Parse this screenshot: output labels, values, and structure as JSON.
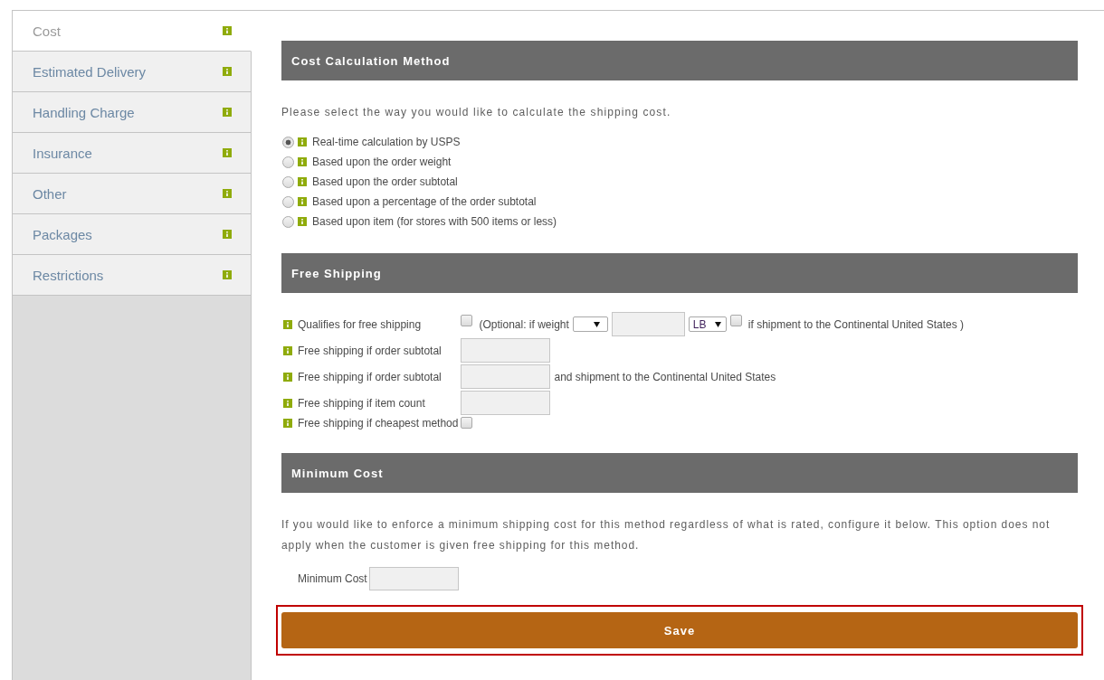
{
  "sidebar": {
    "items": [
      {
        "label": "Cost",
        "selected": true
      },
      {
        "label": "Estimated Delivery",
        "selected": false
      },
      {
        "label": "Handling Charge",
        "selected": false
      },
      {
        "label": "Insurance",
        "selected": false
      },
      {
        "label": "Other",
        "selected": false
      },
      {
        "label": "Packages",
        "selected": false
      },
      {
        "label": "Restrictions",
        "selected": false
      }
    ]
  },
  "cost_calculation_method": {
    "title": "Cost Calculation Method",
    "description": "Please select the way you would like to calculate the shipping cost.",
    "options": [
      {
        "label": "Real-time calculation by USPS",
        "selected": true
      },
      {
        "label": "Based upon the order weight",
        "selected": false
      },
      {
        "label": "Based upon the order subtotal",
        "selected": false
      },
      {
        "label": "Based upon a percentage of the order subtotal",
        "selected": false
      },
      {
        "label": "Based upon item (for stores with 500 items or less)",
        "selected": false
      }
    ]
  },
  "free_shipping": {
    "title": "Free Shipping",
    "rows": [
      {
        "label": "Qualifies for free shipping",
        "controls": [
          {
            "kind": "checkbox",
            "checked": false
          },
          {
            "kind": "text",
            "text": "(Optional: if weight"
          },
          {
            "kind": "select"
          },
          {
            "kind": "input"
          },
          {
            "kind": "select",
            "value": "LB"
          },
          {
            "kind": "checkbox",
            "checked": false
          },
          {
            "kind": "text",
            "text": "if shipment to the Continental United States )"
          }
        ]
      },
      {
        "label": "Free shipping if order subtotal",
        "controls": [
          {
            "kind": "input"
          }
        ]
      },
      {
        "label": "Free shipping if order subtotal",
        "controls": [
          {
            "kind": "input"
          },
          {
            "kind": "text",
            "text": "and shipment to the Continental United States"
          }
        ]
      },
      {
        "label": "Free shipping if item count",
        "controls": [
          {
            "kind": "input"
          }
        ]
      },
      {
        "label": "Free shipping if cheapest method",
        "controls": [
          {
            "kind": "checkbox",
            "checked": false
          }
        ]
      }
    ]
  },
  "minimum_cost": {
    "title": "Minimum Cost",
    "description": "If you would like to enforce a minimum shipping cost for this method regardless of what is rated, configure it below. This option does not apply when the customer is given free shipping for this method.",
    "field": {
      "label": "Minimum Cost"
    }
  },
  "save_button": {
    "label": "Save",
    "highlighted": true
  }
}
